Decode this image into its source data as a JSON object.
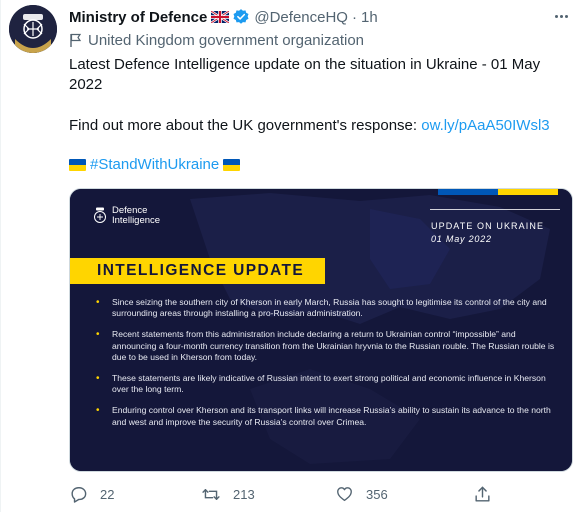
{
  "author": {
    "display_name": "Ministry of Defence",
    "handle": "@DefenceHQ",
    "time": "1h",
    "label": "United Kingdom government organization",
    "verified": true
  },
  "tweet": {
    "line1": "Latest Defence Intelligence update on the situation in Ukraine - 01 May 2022",
    "line2_text": "Find out more about the UK government's response: ",
    "line2_link": "ow.ly/pAaA50IWsl3",
    "hashtag": "#StandWithUkraine"
  },
  "card": {
    "brand_line1": "Defence",
    "brand_line2": "Intelligence",
    "update_title": "UPDATE ON UKRAINE",
    "update_date": "01 May 2022",
    "banner": "INTELLIGENCE UPDATE",
    "bullets": [
      "Since seizing the southern city of Kherson in early March, Russia has sought to legitimise its control of the city and surrounding areas through installing a pro-Russian administration.",
      "Recent statements from this administration include declaring a return to Ukrainian control “impossible” and announcing a four-month currency transition from the Ukrainian hryvnia to the Russian rouble. The Russian rouble is due to be used in Kherson from today.",
      "These statements are likely indicative of Russian intent to exert strong political and economic influence in Kherson over the long term.",
      "Enduring control over Kherson and its transport links will increase Russia’s ability to sustain its advance to the north and west and improve the security of Russia’s control over Crimea."
    ],
    "colors": {
      "background": "#14173a",
      "banner": "#ffd500",
      "ukraine_blue": "#0057b7",
      "ukraine_yellow": "#ffd500"
    }
  },
  "actions": {
    "reply_count": "22",
    "retweet_count": "213",
    "like_count": "356",
    "icons": [
      "reply-icon",
      "retweet-icon",
      "like-icon",
      "share-icon"
    ]
  },
  "colors": {
    "link": "#1d9bf0",
    "secondary_text": "#536471",
    "primary_text": "#0f1419"
  }
}
